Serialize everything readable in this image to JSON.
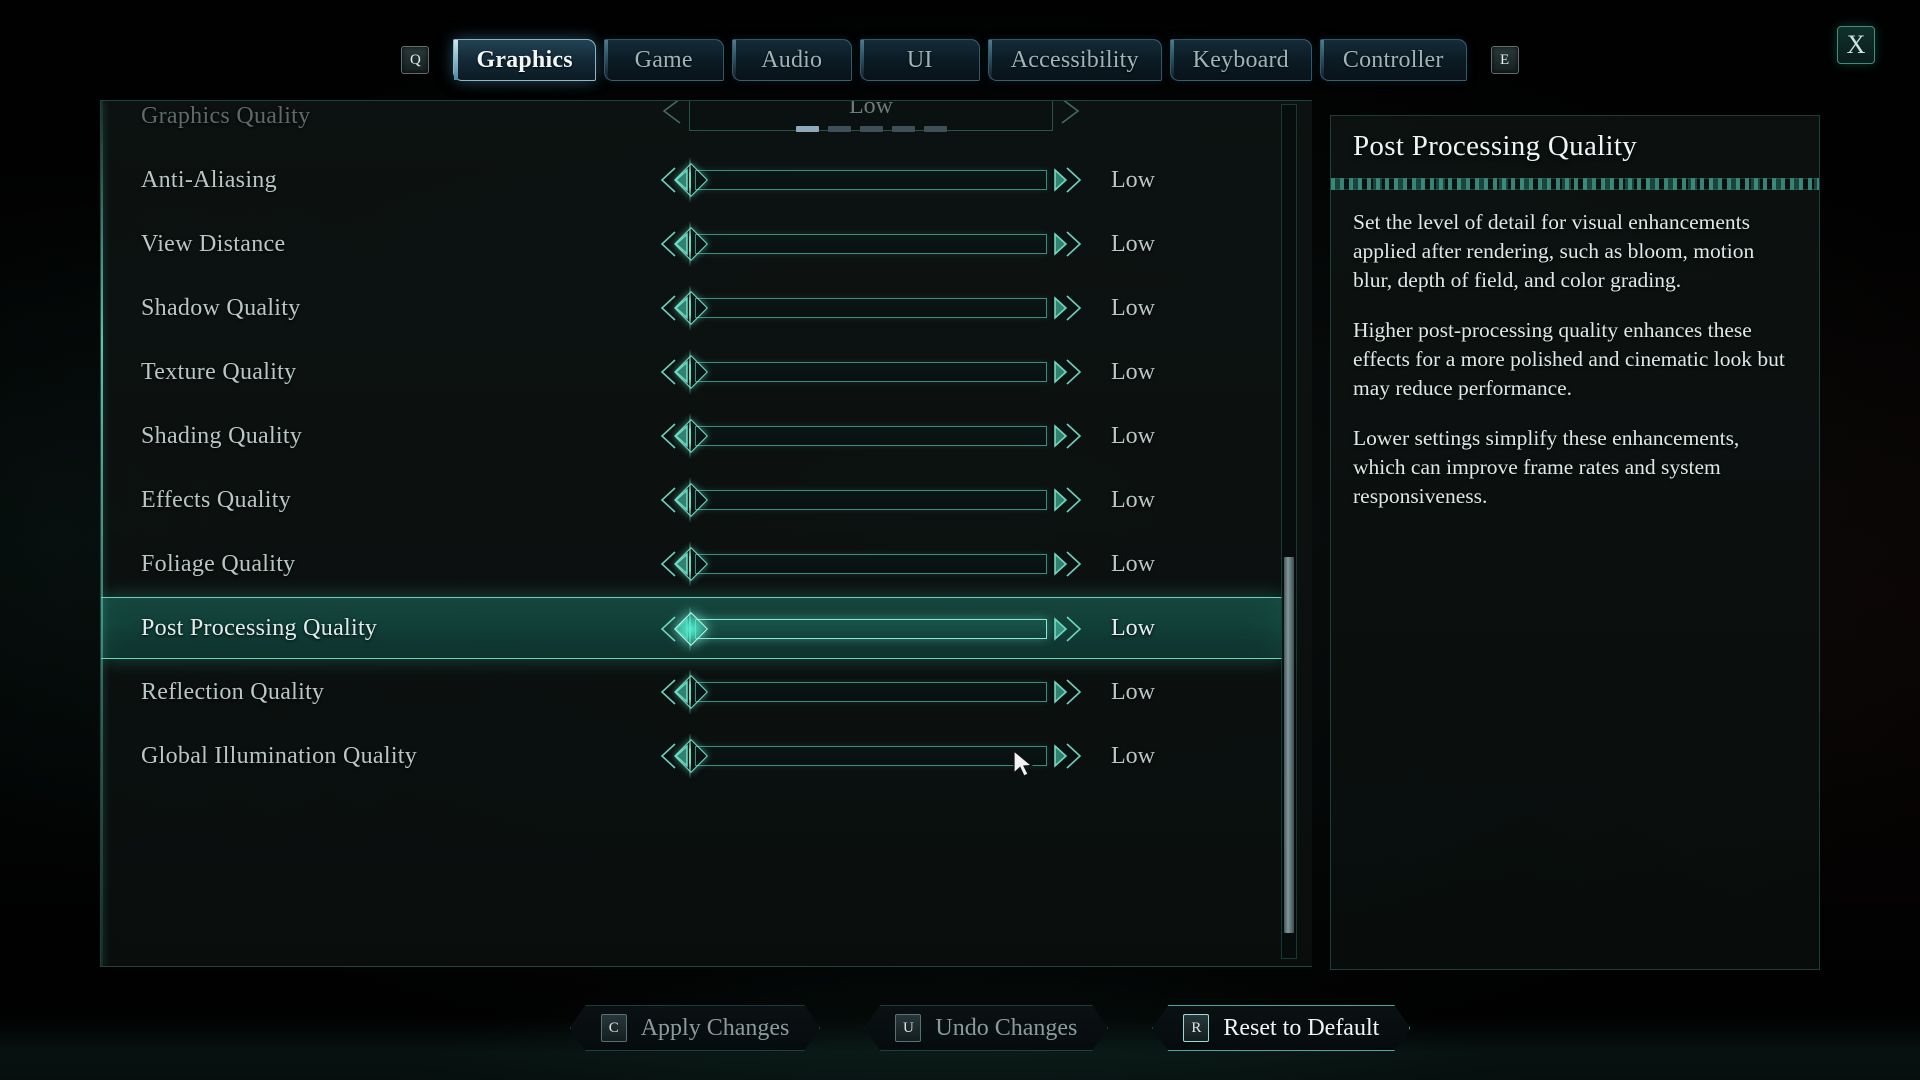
{
  "hints": {
    "prev_key": "Q",
    "next_key": "E"
  },
  "close_button": {
    "label": "X"
  },
  "tabs": [
    {
      "label": "Graphics",
      "active": true
    },
    {
      "label": "Game",
      "active": false
    },
    {
      "label": "Audio",
      "active": false
    },
    {
      "label": "UI",
      "active": false
    },
    {
      "label": "Accessibility",
      "active": false
    },
    {
      "label": "Keyboard",
      "active": false
    },
    {
      "label": "Controller",
      "active": false
    }
  ],
  "settings": [
    {
      "label": "Graphics Quality",
      "value": "Low",
      "type": "stepper",
      "steps": 5,
      "step_index": 0,
      "state": "dim",
      "clipped": true
    },
    {
      "label": "Anti-Aliasing",
      "value": "Low",
      "type": "slider",
      "state": "normal"
    },
    {
      "label": "View Distance",
      "value": "Low",
      "type": "slider",
      "state": "normal"
    },
    {
      "label": "Shadow Quality",
      "value": "Low",
      "type": "slider",
      "state": "normal"
    },
    {
      "label": "Texture Quality",
      "value": "Low",
      "type": "slider",
      "state": "normal"
    },
    {
      "label": "Shading Quality",
      "value": "Low",
      "type": "slider",
      "state": "normal"
    },
    {
      "label": "Effects Quality",
      "value": "Low",
      "type": "slider",
      "state": "normal"
    },
    {
      "label": "Foliage Quality",
      "value": "Low",
      "type": "slider",
      "state": "normal"
    },
    {
      "label": "Post Processing Quality",
      "value": "Low",
      "type": "slider",
      "state": "selected"
    },
    {
      "label": "Reflection Quality",
      "value": "Low",
      "type": "slider",
      "state": "normal"
    },
    {
      "label": "Global Illumination Quality",
      "value": "Low",
      "type": "slider",
      "state": "normal"
    }
  ],
  "info_panel": {
    "title": "Post Processing Quality",
    "paragraphs": [
      "Set the level of detail for visual enhancements applied after rendering, such as bloom, motion blur, depth of field, and color grading.",
      "Higher post-processing quality enhances these effects for a more polished and cinematic look but may reduce performance.",
      "Lower settings simplify these enhancements, which can improve frame rates and system responsiveness."
    ]
  },
  "footer_buttons": [
    {
      "key": "C",
      "label": "Apply Changes",
      "highlight": false
    },
    {
      "key": "U",
      "label": "Undo Changes",
      "highlight": false
    },
    {
      "key": "R",
      "label": "Reset to Default",
      "highlight": true
    }
  ],
  "colors": {
    "accent_teal": "#5fd9bd",
    "tab_blue": "#6fb4d4",
    "background": "#0a0c0b",
    "text_primary": "#dfe8e7",
    "text_muted": "#6a7674"
  }
}
